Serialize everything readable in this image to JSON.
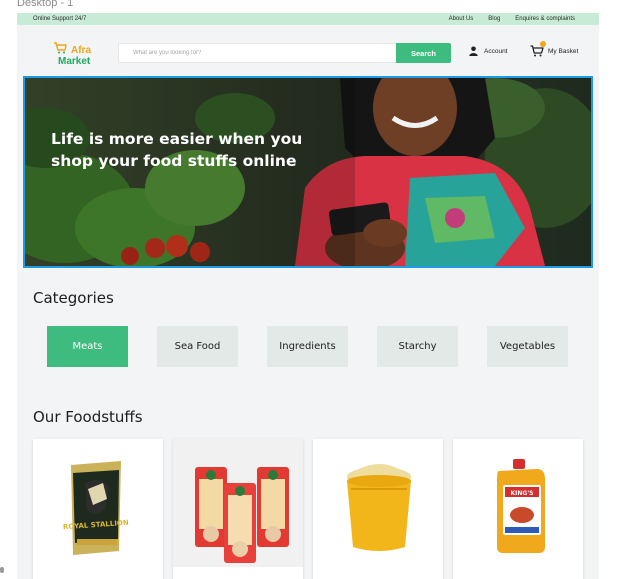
{
  "artboard": {
    "label": "Desktop - 1"
  },
  "topbar": {
    "support": "Online Support 24/7",
    "links": [
      "About Us",
      "Blog",
      "Enquires & complaints"
    ]
  },
  "header": {
    "logo": {
      "line1": "Afra",
      "line2": "Market"
    },
    "search": {
      "placeholder": "What are you looking for?",
      "button": "Search"
    },
    "account_label": "Account",
    "basket_label": "My Basket"
  },
  "hero": {
    "headline_line1": "Life is more easier when you",
    "headline_line2": "shop your food stuffs online"
  },
  "categories": {
    "title": "Categories",
    "items": [
      "Meats",
      "Sea Food",
      "Ingredients",
      "Starchy",
      "Vegetables"
    ],
    "active": "Meats"
  },
  "foodstuffs": {
    "title": "Our Foodstuffs",
    "products": [
      {
        "icon": "rice-bag-image",
        "bag_text": "ROYAL STALLION"
      },
      {
        "icon": "spaghetti-packs-image"
      },
      {
        "icon": "garri-bucket-image"
      },
      {
        "icon": "vegetable-oil-jerrycan-image",
        "jar_text": "KING'S"
      }
    ]
  },
  "colors": {
    "accent": "#3ebc7f",
    "topbar": "#c7ebd6",
    "logo_orange": "#f0a51a",
    "logo_green": "#1faa5f",
    "hero_border": "#1e9be6",
    "category_bg": "#e2e9e7"
  }
}
